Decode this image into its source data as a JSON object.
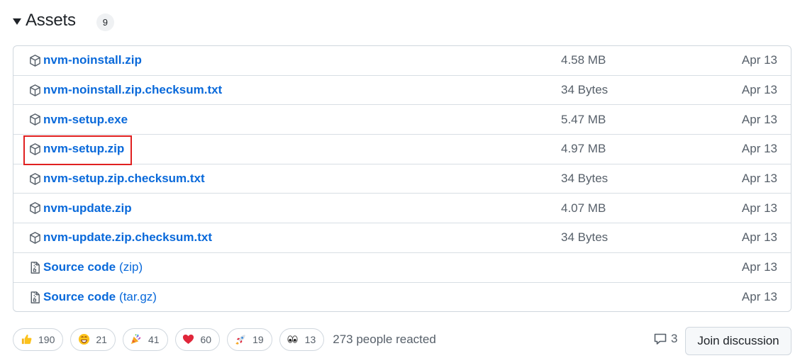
{
  "assets_header": {
    "title": "Assets",
    "count": "9"
  },
  "assets": [
    {
      "name": "nvm-noinstall.zip",
      "suffix": "",
      "size": "4.58 MB",
      "date": "Apr 13",
      "icon": "package-icon"
    },
    {
      "name": "nvm-noinstall.zip.checksum.txt",
      "suffix": "",
      "size": "34 Bytes",
      "date": "Apr 13",
      "icon": "package-icon"
    },
    {
      "name": "nvm-setup.exe",
      "suffix": "",
      "size": "5.47 MB",
      "date": "Apr 13",
      "icon": "package-icon"
    },
    {
      "name": "nvm-setup.zip",
      "suffix": "",
      "size": "4.97 MB",
      "date": "Apr 13",
      "icon": "package-icon",
      "highlighted": true
    },
    {
      "name": "nvm-setup.zip.checksum.txt",
      "suffix": "",
      "size": "34 Bytes",
      "date": "Apr 13",
      "icon": "package-icon"
    },
    {
      "name": "nvm-update.zip",
      "suffix": "",
      "size": "4.07 MB",
      "date": "Apr 13",
      "icon": "package-icon"
    },
    {
      "name": "nvm-update.zip.checksum.txt",
      "suffix": "",
      "size": "34 Bytes",
      "date": "Apr 13",
      "icon": "package-icon"
    },
    {
      "name": "Source code",
      "suffix": "(zip)",
      "size": "",
      "date": "Apr 13",
      "icon": "file-zip-icon"
    },
    {
      "name": "Source code",
      "suffix": "(tar.gz)",
      "size": "",
      "date": "Apr 13",
      "icon": "file-zip-icon"
    }
  ],
  "reactions": [
    {
      "emoji": "thumbs-up",
      "count": "190"
    },
    {
      "emoji": "laugh",
      "count": "21"
    },
    {
      "emoji": "hooray",
      "count": "41"
    },
    {
      "emoji": "heart",
      "count": "60"
    },
    {
      "emoji": "rocket",
      "count": "19"
    },
    {
      "emoji": "eyes",
      "count": "13"
    }
  ],
  "reacted_text": "273 people reacted",
  "discussion": {
    "count": "3",
    "join_label": "Join discussion"
  },
  "colors": {
    "link": "#0969da",
    "muted": "#57606a",
    "border": "#d0d7de",
    "highlight": "#e02020"
  }
}
